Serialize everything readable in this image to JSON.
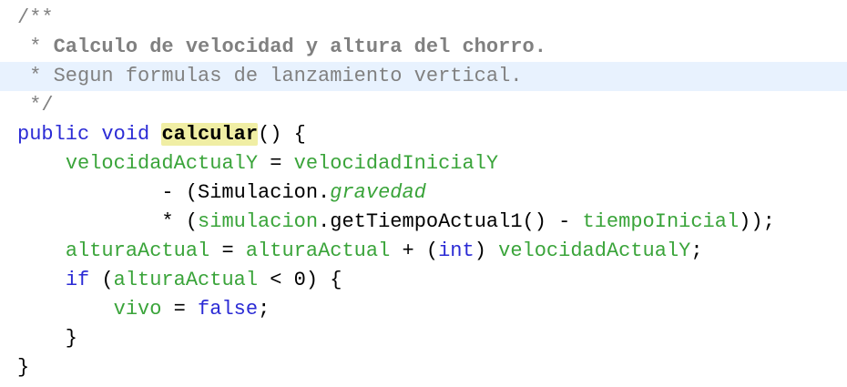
{
  "editor": {
    "lines": [
      {
        "highlighted": false,
        "tokens": [
          {
            "cls": "comment",
            "text": "/**"
          }
        ]
      },
      {
        "highlighted": false,
        "tokens": [
          {
            "cls": "comment",
            "text": " * "
          },
          {
            "cls": "comment-bold",
            "text": "Calculo de velocidad y altura del chorro."
          }
        ]
      },
      {
        "highlighted": true,
        "tokens": [
          {
            "cls": "comment",
            "text": " * Segun formulas de lanzamiento vertical."
          }
        ]
      },
      {
        "highlighted": false,
        "tokens": [
          {
            "cls": "comment",
            "text": " */"
          }
        ]
      },
      {
        "highlighted": false,
        "tokens": [
          {
            "cls": "keyword",
            "text": "public"
          },
          {
            "cls": "plain",
            "text": " "
          },
          {
            "cls": "keyword",
            "text": "void"
          },
          {
            "cls": "plain",
            "text": " "
          },
          {
            "cls": "method-decl",
            "text": "calcular"
          },
          {
            "cls": "plain",
            "text": "() {"
          }
        ]
      },
      {
        "highlighted": false,
        "tokens": [
          {
            "cls": "plain",
            "text": "    "
          },
          {
            "cls": "field",
            "text": "velocidadActualY"
          },
          {
            "cls": "plain",
            "text": " = "
          },
          {
            "cls": "field",
            "text": "velocidadInicialY"
          }
        ]
      },
      {
        "highlighted": false,
        "tokens": [
          {
            "cls": "plain",
            "text": "            - (Simulacion."
          },
          {
            "cls": "static-field",
            "text": "gravedad"
          }
        ]
      },
      {
        "highlighted": false,
        "tokens": [
          {
            "cls": "plain",
            "text": "            * ("
          },
          {
            "cls": "field",
            "text": "simulacion"
          },
          {
            "cls": "plain",
            "text": ".getTiempoActual1() - "
          },
          {
            "cls": "field",
            "text": "tiempoInicial"
          },
          {
            "cls": "plain",
            "text": "));"
          }
        ]
      },
      {
        "highlighted": false,
        "tokens": [
          {
            "cls": "plain",
            "text": "    "
          },
          {
            "cls": "field",
            "text": "alturaActual"
          },
          {
            "cls": "plain",
            "text": " = "
          },
          {
            "cls": "field",
            "text": "alturaActual"
          },
          {
            "cls": "plain",
            "text": " + ("
          },
          {
            "cls": "keyword",
            "text": "int"
          },
          {
            "cls": "plain",
            "text": ") "
          },
          {
            "cls": "field",
            "text": "velocidadActualY"
          },
          {
            "cls": "plain",
            "text": ";"
          }
        ]
      },
      {
        "highlighted": false,
        "tokens": [
          {
            "cls": "plain",
            "text": "    "
          },
          {
            "cls": "keyword",
            "text": "if"
          },
          {
            "cls": "plain",
            "text": " ("
          },
          {
            "cls": "field",
            "text": "alturaActual"
          },
          {
            "cls": "plain",
            "text": " < 0) {"
          }
        ]
      },
      {
        "highlighted": false,
        "tokens": [
          {
            "cls": "plain",
            "text": "        "
          },
          {
            "cls": "field",
            "text": "vivo"
          },
          {
            "cls": "plain",
            "text": " = "
          },
          {
            "cls": "keyword",
            "text": "false"
          },
          {
            "cls": "plain",
            "text": ";"
          }
        ]
      },
      {
        "highlighted": false,
        "tokens": [
          {
            "cls": "plain",
            "text": "    }"
          }
        ]
      },
      {
        "highlighted": false,
        "tokens": [
          {
            "cls": "plain",
            "text": "}"
          }
        ]
      }
    ]
  }
}
